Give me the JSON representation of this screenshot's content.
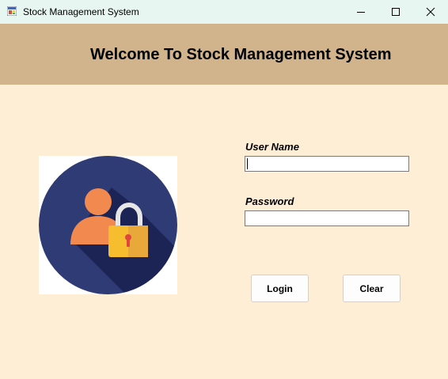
{
  "window": {
    "title": "Stock Management System",
    "icons": {
      "app": "app-form-icon",
      "minimize": "minimize-icon",
      "maximize": "maximize-icon",
      "close": "close-icon"
    }
  },
  "header": {
    "title": "Welcome To Stock Management System"
  },
  "illustration": {
    "icon": "user-lock-icon"
  },
  "form": {
    "username_label": "User Name",
    "username_value": "",
    "password_label": "Password",
    "password_value": ""
  },
  "buttons": {
    "login": "Login",
    "clear": "Clear"
  },
  "colors": {
    "titlebar_bg": "#E8F6F1",
    "header_bg": "#D2B48C",
    "form_bg": "#FFEED6",
    "avatar_circle": "#2E3B74",
    "avatar_person": "#F28A50",
    "lock_body": "#F6BE2E",
    "lock_shackle": "#E6E6E6"
  }
}
